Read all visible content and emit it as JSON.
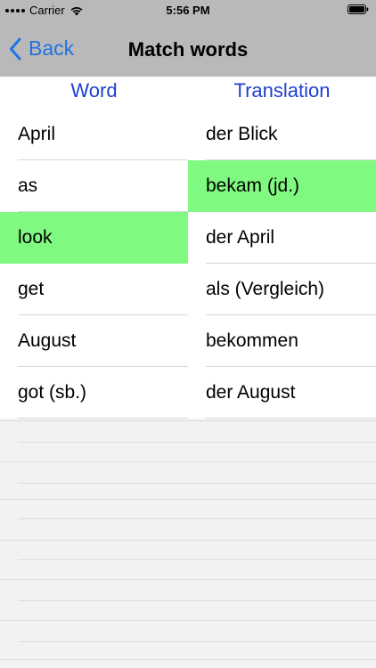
{
  "status_bar": {
    "carrier": "Carrier",
    "time": "5:56 PM",
    "icons": [
      "signal-dots-icon",
      "wifi-icon",
      "battery-icon"
    ]
  },
  "nav": {
    "back_label": "Back",
    "title": "Match words",
    "accent_color": "#1e74e4"
  },
  "columns": {
    "word_header": "Word",
    "translation_header": "Translation",
    "header_color": "#1f3fd0"
  },
  "selection_color": "#80f980",
  "words": [
    {
      "text": "April",
      "selected": false
    },
    {
      "text": "as",
      "selected": false
    },
    {
      "text": "look",
      "selected": true
    },
    {
      "text": "get",
      "selected": false
    },
    {
      "text": "August",
      "selected": false
    },
    {
      "text": "got (sb.)",
      "selected": false
    }
  ],
  "translations": [
    {
      "text": "der Blick",
      "selected": false
    },
    {
      "text": "bekam (jd.)",
      "selected": true
    },
    {
      "text": "der April",
      "selected": false
    },
    {
      "text": "als (Vergleich)",
      "selected": false
    },
    {
      "text": "bekommen",
      "selected": false
    },
    {
      "text": "der August",
      "selected": false
    }
  ]
}
